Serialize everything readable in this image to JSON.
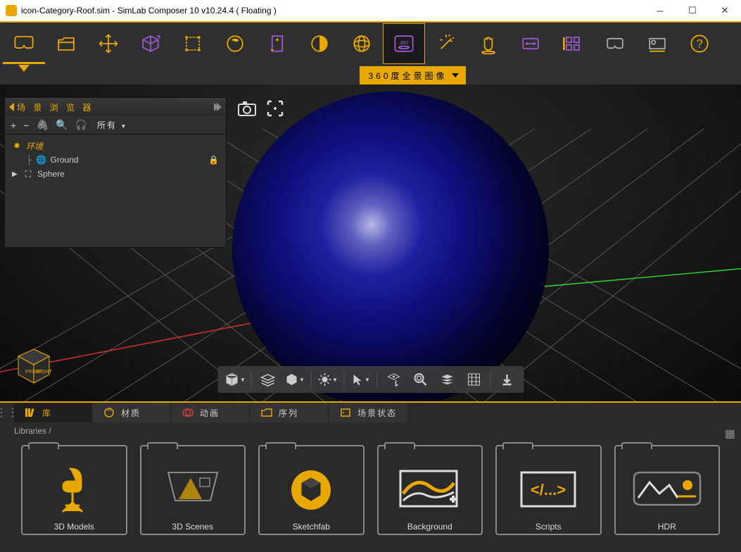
{
  "window": {
    "title": "icon-Category-Roof.sim - SimLab Composer 10 v10.24.4 ( Floating )"
  },
  "submenu": {
    "label": "360度全景图像"
  },
  "sceneBrowser": {
    "title": "场 景 浏 览 器",
    "filter": "所有",
    "items": [
      {
        "label": "环境",
        "icon": "env"
      },
      {
        "label": "Ground",
        "icon": "globe",
        "locked": true
      },
      {
        "label": "Sphere",
        "icon": "mesh",
        "expandable": true
      }
    ]
  },
  "bottomPanel": {
    "tabs": [
      {
        "label": "库",
        "active": true
      },
      {
        "label": "材质"
      },
      {
        "label": "动画"
      },
      {
        "label": "序列"
      },
      {
        "label": "场景状态"
      }
    ],
    "breadcrumb": "Libraries  /",
    "libraries": [
      {
        "label": "3D Models"
      },
      {
        "label": "3D Scenes"
      },
      {
        "label": "Sketchfab"
      },
      {
        "label": "Background"
      },
      {
        "label": "Scripts"
      },
      {
        "label": "HDR"
      }
    ]
  },
  "navCube": {
    "front": "FRONT",
    "right": "RIGHT"
  }
}
